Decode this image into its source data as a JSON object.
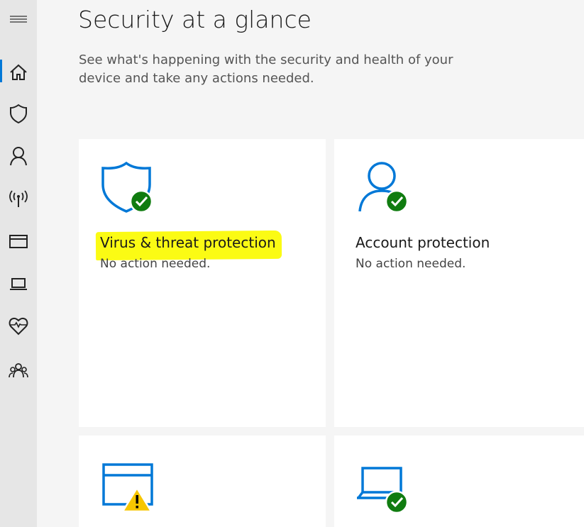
{
  "page": {
    "title": "Security at a glance",
    "description": "See what's happening with the security and health of your device and take any actions needed."
  },
  "sidebar": {
    "items": [
      {
        "name": "menu-icon"
      },
      {
        "name": "home-icon"
      },
      {
        "name": "shield-icon"
      },
      {
        "name": "person-icon"
      },
      {
        "name": "wireless-icon"
      },
      {
        "name": "browser-window-icon"
      },
      {
        "name": "laptop-icon"
      },
      {
        "name": "heart-pulse-icon"
      },
      {
        "name": "family-icon"
      }
    ],
    "active_index": 1
  },
  "tiles": [
    {
      "title": "Virus & threat protection",
      "status": "No action needed.",
      "icon": "shield-check-icon",
      "status_color": "#107c10"
    },
    {
      "title": "Account protection",
      "status": "No action needed.",
      "icon": "person-check-icon",
      "status_color": "#107c10"
    },
    {
      "title": "",
      "status": "",
      "icon": "browser-warning-icon",
      "status_color": "#f7c600"
    },
    {
      "title": "",
      "status": "",
      "icon": "laptop-check-icon",
      "status_color": "#107c10"
    }
  ],
  "colors": {
    "accent": "#0078d7",
    "ok": "#107c10",
    "warning": "#f7c600",
    "highlight": "#fbfb14"
  }
}
